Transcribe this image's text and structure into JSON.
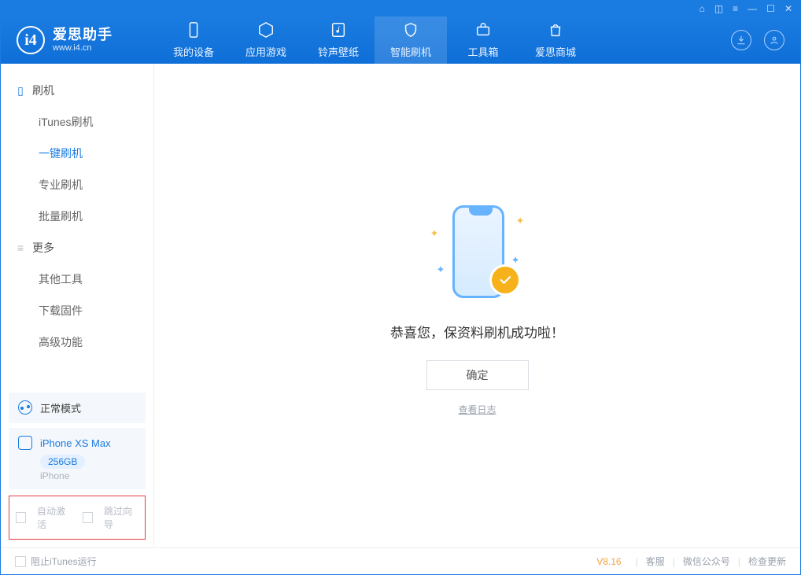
{
  "app": {
    "name_cn": "爱思助手",
    "url": "www.i4.cn"
  },
  "topnav": {
    "my_device": "我的设备",
    "apps_games": "应用游戏",
    "ring_wall": "铃声壁纸",
    "smart_flash": "智能刷机",
    "toolbox": "工具箱",
    "store": "爱思商城"
  },
  "sidebar": {
    "section_flash": "刷机",
    "section_more": "更多",
    "items": {
      "itunes_flash": "iTunes刷机",
      "one_key_flash": "一键刷机",
      "pro_flash": "专业刷机",
      "batch_flash": "批量刷机",
      "other_tools": "其他工具",
      "dl_firmware": "下载固件",
      "advanced": "高级功能"
    }
  },
  "mode": {
    "label": "正常模式"
  },
  "device": {
    "name": "iPhone XS Max",
    "capacity": "256GB",
    "type": "iPhone"
  },
  "options": {
    "auto_activate": "自动激活",
    "skip_guide": "跳过向导"
  },
  "main": {
    "success_text": "恭喜您，保资料刷机成功啦！",
    "ok": "确定",
    "view_log": "查看日志"
  },
  "footer": {
    "block_itunes": "阻止iTunes运行",
    "version": "V8.16",
    "service": "客服",
    "wechat": "微信公众号",
    "check_update": "检查更新"
  },
  "win": {
    "min": "—",
    "max": "☐",
    "close": "✕"
  }
}
